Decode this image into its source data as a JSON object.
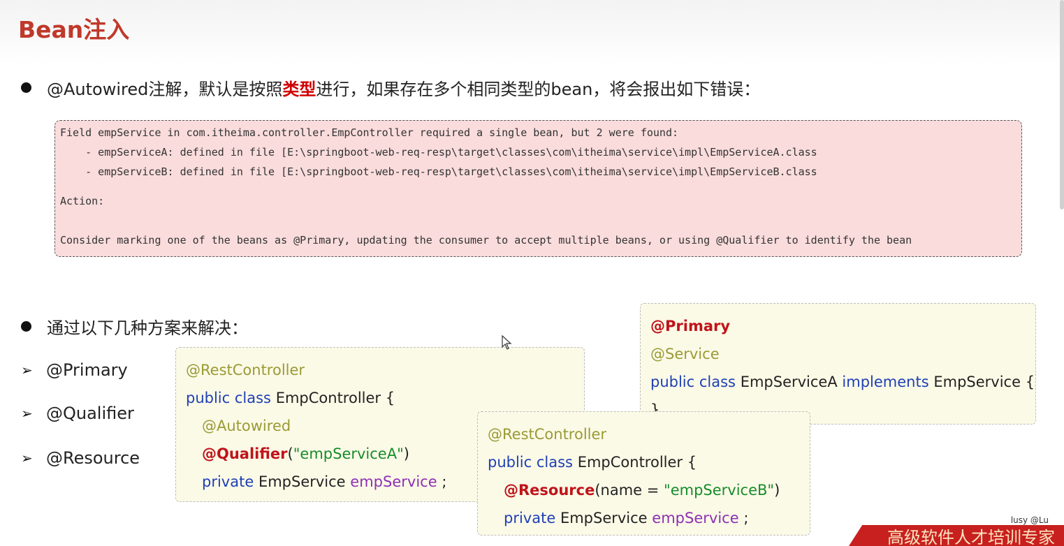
{
  "slide": {
    "title": "Bean注入",
    "bullet1": {
      "prefix": "@Autowired注解，默认是按照",
      "highlight": "类型",
      "suffix": "进行，如果存在多个相同类型的bean，将会报出如下错误："
    },
    "error_lines": [
      "Field empService in com.itheima.controller.EmpController required a single bean, but 2 were found:",
      "    - empServiceA: defined in file [E:\\springboot-web-req-resp\\target\\classes\\com\\itheima\\service\\impl\\EmpServiceA.class",
      "    - empServiceB: defined in file [E:\\springboot-web-req-resp\\target\\classes\\com\\itheima\\service\\impl\\EmpServiceB.class",
      "Action:",
      "Consider marking one of the beans as @Primary, updating the consumer to accept multiple beans, or using @Qualifier to identify the bean"
    ],
    "bullet2": "通过以下几种方案来解决：",
    "options": [
      "@Primary",
      "@Qualifier",
      "@Resource"
    ],
    "code_primary": {
      "a1": "@Primary",
      "a2": "@Service",
      "kw": "public class",
      "cls": "EmpServiceA",
      "impl": "implements",
      "iface": "EmpService {",
      "close": "}"
    },
    "code_qualifier": {
      "a1": "@RestController",
      "kw": "public class",
      "cls": "EmpController {",
      "a2": "@Autowired",
      "a3": "@Qualifier",
      "p_open": "(",
      "arg": "\"empServiceA\"",
      "p_close": ")",
      "priv": "private",
      "type": "EmpService",
      "field": "empService",
      "semi": ";"
    },
    "code_resource": {
      "a1": "@RestController",
      "kw": "public class",
      "cls": "EmpController {",
      "a2": "@Resource",
      "p_open": "(name = ",
      "arg": "\"empServiceB\"",
      "p_close": ")",
      "priv": "private",
      "type": "EmpService",
      "field": "empService",
      "semi": ";"
    },
    "watermark": "lusy @Lu",
    "banner": "高级软件人才培训专家"
  }
}
